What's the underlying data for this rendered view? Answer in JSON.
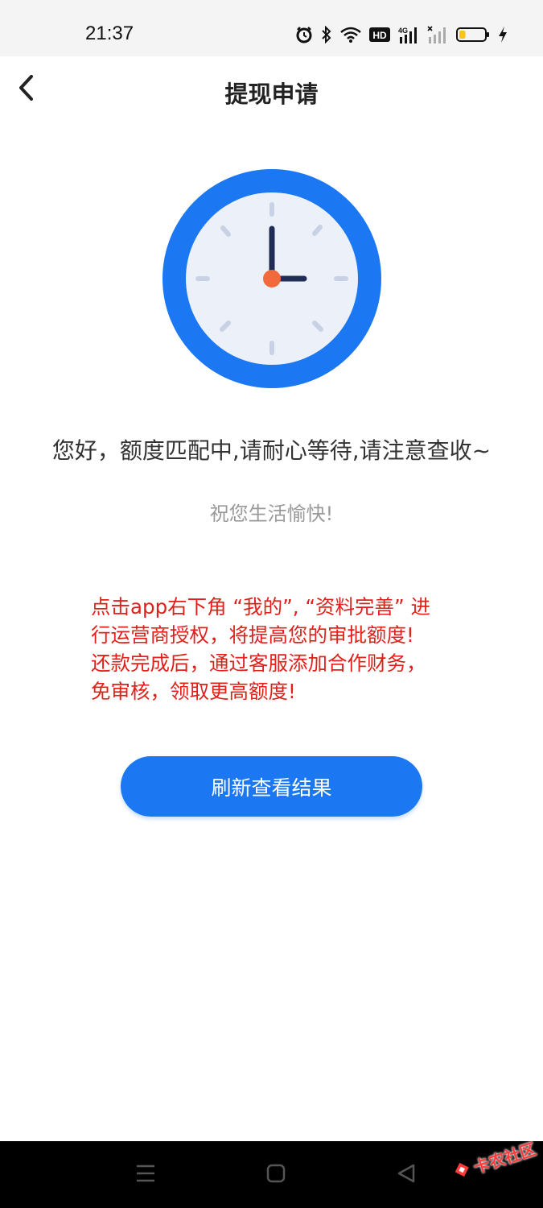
{
  "status_bar": {
    "time": "21:37",
    "icons": [
      "alarm-icon",
      "bluetooth-icon",
      "wifi-icon",
      "hd-icon",
      "signal-4g-icon",
      "signal-icon",
      "battery-icon",
      "charging-icon"
    ],
    "hd_label": "HD",
    "network_label": "4G",
    "battery_level": 0.25
  },
  "header": {
    "title": "提现申请",
    "back_icon": "chevron-left-icon"
  },
  "illustration": {
    "icon": "clock-icon",
    "colors": {
      "ring": "#1b78f2",
      "face": "#ecf1f9",
      "hands": "#1f2d56",
      "center": "#f26a3c",
      "ticks": "#c8d2e4"
    }
  },
  "content": {
    "main_message": "您好，额度匹配中,请耐心等待,请注意查收~",
    "sub_message": "祝您生活愉快!",
    "notice_lines": [
      "点击app右下角 “我的”, “资料完善” 进",
      "行运营商授权，将提高您的审批额度!",
      "还款完成后，通过客服添加合作财务，",
      "免审核，领取更高额度!"
    ],
    "notice_color": "#e0211b"
  },
  "actions": {
    "refresh_label": "刷新查看结果",
    "accent_color": "#1b78f2"
  },
  "system_nav": {
    "buttons": [
      "menu-icon",
      "home-icon",
      "back-triangle-icon"
    ]
  },
  "watermark": {
    "text": "卡农社区"
  }
}
